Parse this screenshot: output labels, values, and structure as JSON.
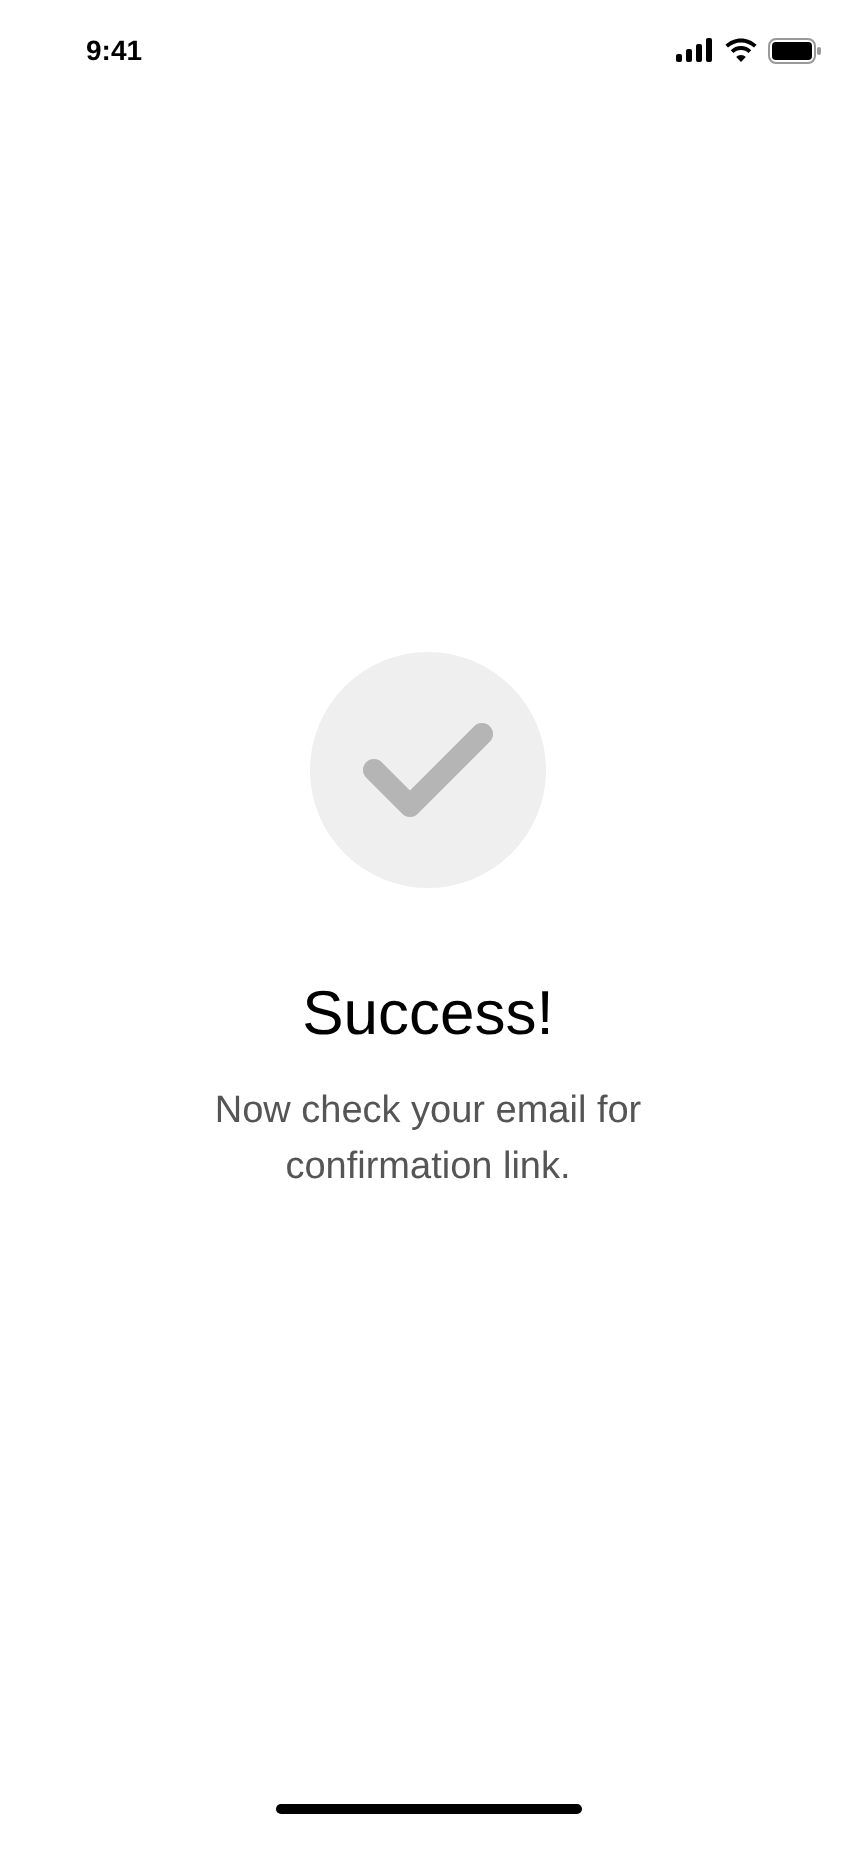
{
  "status_bar": {
    "time": "9:41"
  },
  "title": "Success!",
  "message": "Now check your email for confirmation link."
}
